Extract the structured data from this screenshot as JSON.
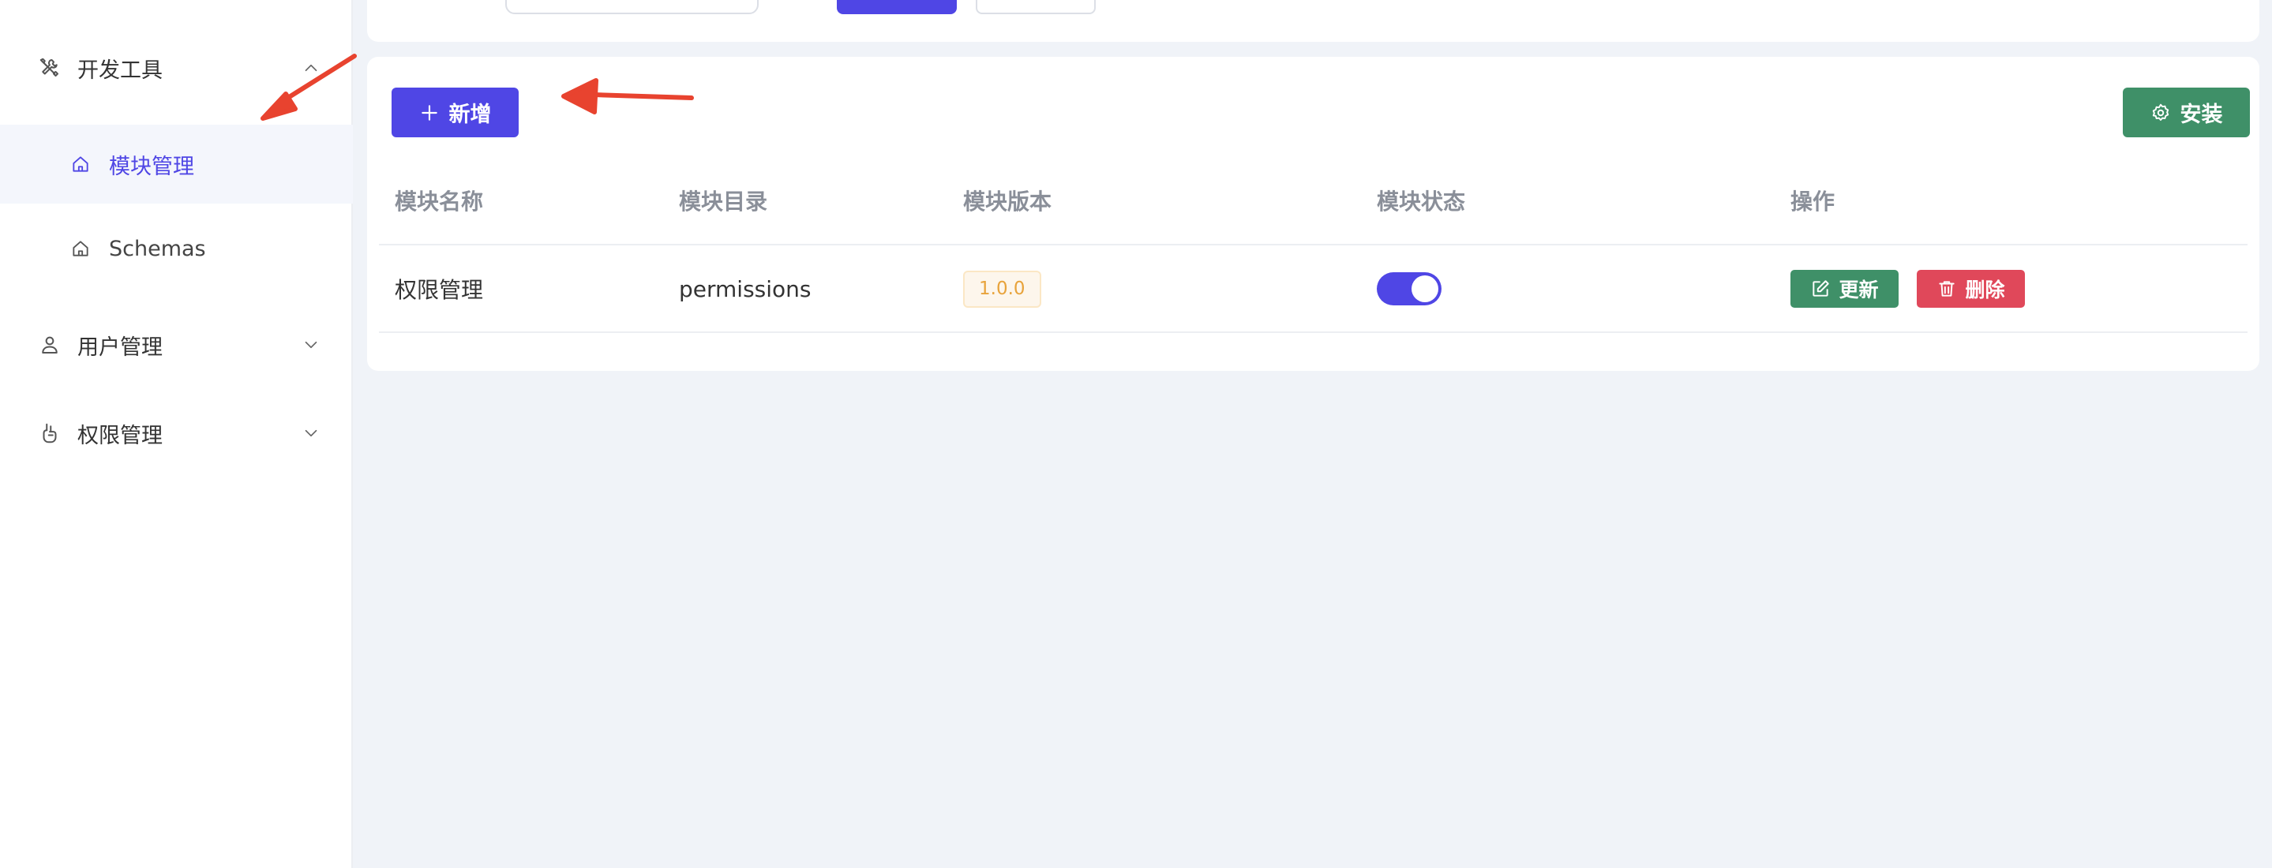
{
  "sidebar": {
    "items": [
      {
        "label": "开发工具",
        "icon": "tools-icon",
        "expanded": true,
        "children": [
          {
            "label": "模块管理",
            "icon": "home-icon",
            "active": true
          },
          {
            "label": "Schemas",
            "icon": "home-icon",
            "active": false
          }
        ]
      },
      {
        "label": "用户管理",
        "icon": "user-icon",
        "expanded": false
      },
      {
        "label": "权限管理",
        "icon": "shield-hand-icon",
        "expanded": false
      }
    ]
  },
  "toolbar": {
    "add_label": "新增",
    "install_label": "安装"
  },
  "table": {
    "columns": [
      "模块名称",
      "模块目录",
      "模块版本",
      "模块状态",
      "操作"
    ],
    "rows": [
      {
        "name": "权限管理",
        "directory": "permissions",
        "version": "1.0.0",
        "status_enabled": true,
        "actions": {
          "update": "更新",
          "delete": "删除"
        }
      }
    ]
  },
  "colors": {
    "primary": "#4f46e5",
    "success": "#3f9068",
    "danger": "#e0485a",
    "warning_text": "#e8a33b",
    "annotation": "#e8432f"
  }
}
